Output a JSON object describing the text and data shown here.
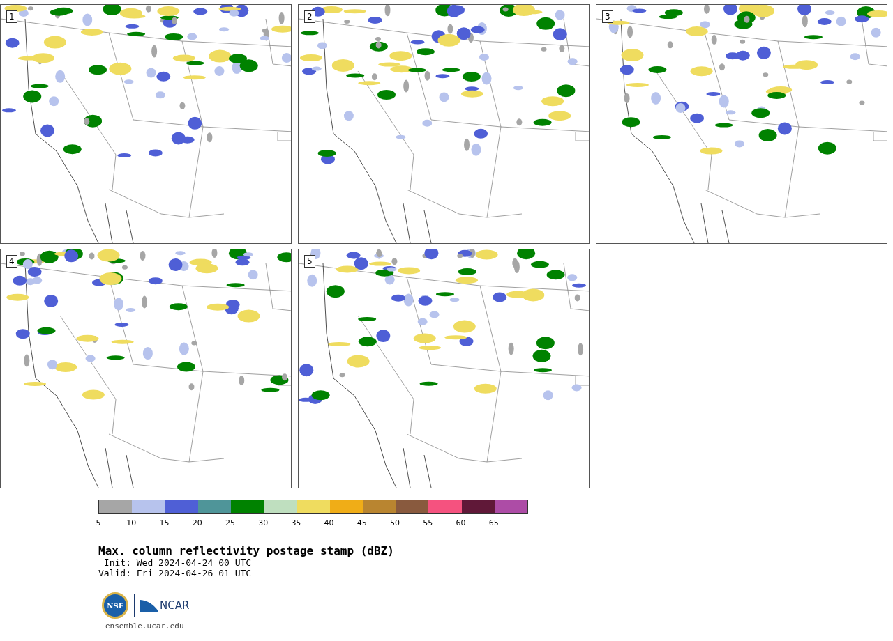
{
  "panels": [
    {
      "number": "1"
    },
    {
      "number": "2"
    },
    {
      "number": "3"
    },
    {
      "number": "4"
    },
    {
      "number": "5"
    }
  ],
  "colorbar": {
    "segments": [
      {
        "color": "#a6a6a6"
      },
      {
        "color": "#b7c3ed"
      },
      {
        "color": "#4f5fd6"
      },
      {
        "color": "#4f9599"
      },
      {
        "color": "#008200"
      },
      {
        "color": "#bfdfbf"
      },
      {
        "color": "#efdc5f"
      },
      {
        "color": "#f0ad17"
      },
      {
        "color": "#b98530"
      },
      {
        "color": "#895a3e"
      },
      {
        "color": "#f5527f"
      },
      {
        "color": "#601838"
      },
      {
        "color": "#ad4ca6"
      }
    ],
    "ticks": [
      "5",
      "10",
      "15",
      "20",
      "25",
      "30",
      "35",
      "40",
      "45",
      "50",
      "55",
      "60",
      "65"
    ]
  },
  "title": "Max. column reflectivity postage stamp (dBZ)",
  "init": " Init: Wed 2024-04-24 00 UTC",
  "valid": "Valid: Fri 2024-04-26 01 UTC",
  "logo": {
    "seal": "NSF",
    "wordmark": "NCAR"
  },
  "url": "ensemble.ucar.edu"
}
